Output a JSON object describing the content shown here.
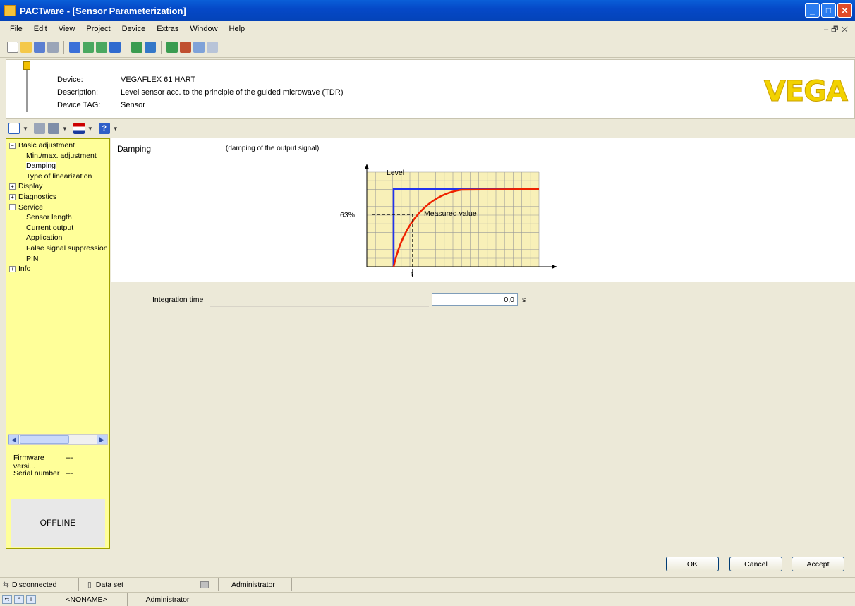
{
  "window": {
    "title": "PACTware - [Sensor Parameterization]"
  },
  "menu": [
    "File",
    "Edit",
    "View",
    "Project",
    "Device",
    "Extras",
    "Window",
    "Help"
  ],
  "device": {
    "device_label": "Device:",
    "device_value": "VEGAFLEX 61 HART",
    "description_label": "Description:",
    "description_value": "Level sensor acc. to the principle of the guided microwave (TDR)",
    "tag_label": "Device TAG:",
    "tag_value": "Sensor",
    "brand": "VEGA"
  },
  "tree": [
    {
      "label": "Basic adjustment",
      "type": "group",
      "expanded": true
    },
    {
      "label": "Min./max. adjustment",
      "type": "child"
    },
    {
      "label": "Damping",
      "type": "child",
      "selected": true
    },
    {
      "label": "Type of linearization",
      "type": "child"
    },
    {
      "label": "Display",
      "type": "group",
      "expanded": false
    },
    {
      "label": "Diagnostics",
      "type": "group",
      "expanded": false
    },
    {
      "label": "Service",
      "type": "group",
      "expanded": true
    },
    {
      "label": "Sensor length",
      "type": "child"
    },
    {
      "label": "Current output",
      "type": "child"
    },
    {
      "label": "Application",
      "type": "child"
    },
    {
      "label": "False signal suppression",
      "type": "child"
    },
    {
      "label": "PIN",
      "type": "child"
    },
    {
      "label": "Info",
      "type": "group",
      "expanded": false
    }
  ],
  "meta": {
    "firmware_label": "Firmware versi...",
    "firmware_value": "---",
    "serial_label": "Serial number",
    "serial_value": "---",
    "status": "OFFLINE"
  },
  "content": {
    "title": "Damping",
    "description": "(damping of the output signal)",
    "diagram": {
      "y_label": "Level",
      "x_label": "t",
      "pct_label": "63%",
      "curve_label": "Measured value",
      "colors": {
        "step": "#2233ee",
        "curve": "#ee2200",
        "grid": "#f8f0b8"
      }
    },
    "param": {
      "label": "Integration time",
      "value": "0,0",
      "unit": "s"
    }
  },
  "buttons": {
    "ok": "OK",
    "cancel": "Cancel",
    "accept": "Accept"
  },
  "status": {
    "connection": "Disconnected",
    "dataset": "Data set",
    "user": "Administrator",
    "project": "<NONAME>",
    "user2": "Administrator"
  }
}
